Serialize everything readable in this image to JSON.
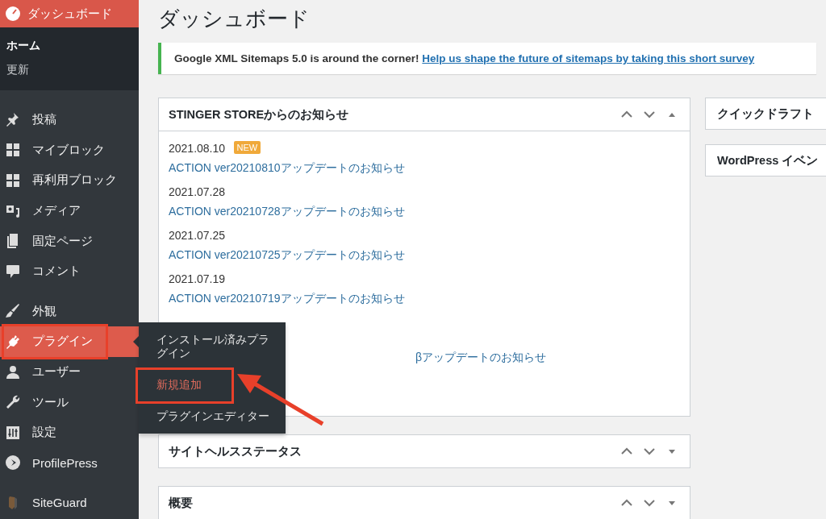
{
  "menu": {
    "dashboard": {
      "label": "ダッシュボード",
      "selected": true
    },
    "submenu": [
      {
        "label": "ホーム",
        "selected": true
      },
      {
        "label": "更新",
        "selected": false
      }
    ],
    "groups": [
      {
        "items": [
          {
            "label": "投稿",
            "kind": "pin",
            "open": false,
            "highlighted": false
          },
          {
            "label": "マイブロック",
            "kind": "grid",
            "open": false,
            "highlighted": false
          },
          {
            "label": "再利用ブロック",
            "kind": "grid",
            "open": false,
            "highlighted": false
          },
          {
            "label": "メディア",
            "kind": "media",
            "open": false,
            "highlighted": false
          },
          {
            "label": "固定ページ",
            "kind": "pages",
            "open": false,
            "highlighted": false
          },
          {
            "label": "コメント",
            "kind": "comment",
            "open": false,
            "highlighted": false
          }
        ]
      },
      {
        "items": [
          {
            "label": "外観",
            "kind": "brush",
            "open": false,
            "highlighted": false
          },
          {
            "label": "プラグイン",
            "kind": "plug",
            "open": true,
            "highlighted": true
          },
          {
            "label": "ユーザー",
            "kind": "user",
            "open": false,
            "highlighted": false
          },
          {
            "label": "ツール",
            "kind": "wrench",
            "open": false,
            "highlighted": false
          },
          {
            "label": "設定",
            "kind": "sliders",
            "open": false,
            "highlighted": false
          },
          {
            "label": "ProfilePress",
            "kind": "badge",
            "open": false,
            "highlighted": false
          }
        ]
      },
      {
        "items": [
          {
            "label": "SiteGuard",
            "kind": "shield",
            "open": false,
            "highlighted": false
          }
        ]
      }
    ]
  },
  "flyout": [
    {
      "label": "インストール済みプラグイン",
      "selected": false,
      "highlighted": false
    },
    {
      "label": "新規追加",
      "selected": true,
      "highlighted": true
    },
    {
      "label": "プラグインエディター",
      "selected": false,
      "highlighted": false
    }
  ],
  "page_title": "ダッシュボード",
  "notice": {
    "text": "Google XML Sitemaps 5.0 is around the corner!",
    "link": "Help us shape the future of sitemaps by taking this short survey"
  },
  "widgets": [
    {
      "title": "STINGER STOREからのお知らせ",
      "expanded": true,
      "news": [
        {
          "date": "2021.08.10",
          "badge": "NEW",
          "link": "ACTION ver20210810アップデートのお知らせ"
        },
        {
          "date": "2021.07.28",
          "link": "ACTION ver20210728アップデートのお知らせ"
        },
        {
          "date": "2021.07.25",
          "link": "ACTION ver20210725アップデートのお知らせ"
        },
        {
          "date": "2021.07.19",
          "link": "ACTION ver20210719アップデートのお知らせ"
        },
        {
          "link": "βアップデートのお知らせ"
        }
      ]
    },
    {
      "title": "サイトヘルスステータス",
      "expanded": false
    },
    {
      "title": "概要",
      "expanded": false
    }
  ],
  "side_widgets": [
    {
      "title": "クイックドラフト"
    },
    {
      "title": "WordPress イベン"
    }
  ]
}
